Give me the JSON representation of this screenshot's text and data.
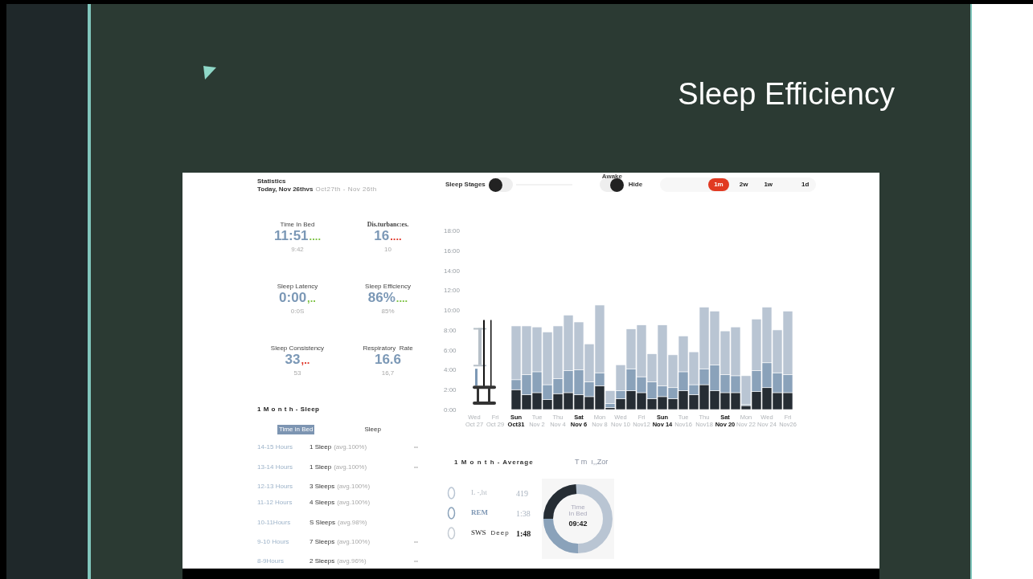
{
  "slide": {
    "title": "Sleep Efficiency"
  },
  "statistics": {
    "title": "Statistics",
    "today": "Today, Nov 26thvs",
    "range": "Oct27th - Nov 26th",
    "metrics": [
      {
        "label": "Time In Bed",
        "value": "11:51",
        "trend": "....",
        "color": "#7cc242",
        "previous": "9:42"
      },
      {
        "label": "Dis.turbanc:es.",
        "value": "16",
        "trend": "....",
        "color": "#e0382c",
        "previous": "10"
      },
      {
        "label": "Sleep Latency",
        "value": "0:00",
        "trend": ",..",
        "color": "#7cc242",
        "previous": "0:0S"
      },
      {
        "label": "Sleep Efficiency",
        "value": "86%",
        "trend": "....",
        "color": "#7cc242",
        "previous": "85%"
      },
      {
        "label": "Sleep Consistency",
        "value": "33",
        "trend": ",..",
        "color": "#e0382c",
        "previous": "53"
      },
      {
        "label": "Respiratory  Rate",
        "value": "16.6",
        "previous": "16,7"
      }
    ]
  },
  "sleep_table": {
    "title": "1 M o n t h - Sleep",
    "columns": [
      {
        "label": "Time in Bed",
        "selected": true
      },
      {
        "label": "Sleep",
        "selected": false
      }
    ],
    "rows": [
      {
        "hours": "14-15 Hours",
        "count": "1 Sleep",
        "avg": "(avg.100%)",
        "note": "••"
      },
      {
        "hours": "13-14 Hours",
        "count": "1 Sleep",
        "avg": "(avg.100%)",
        "note": "••"
      },
      {
        "hours": "12-13 Hours",
        "count": "3 Sleeps",
        "avg": "(avg.100%)"
      },
      {
        "hours": "11-12 Hours",
        "count": "4 Sleeps",
        "avg": "(avg.100%)"
      },
      {
        "hours": "10-11Hours",
        "count": "S Sleeps",
        "avg": "(avg.98%)"
      },
      {
        "hours": "9-10 Hours",
        "count": "7 Sleeps",
        "avg": "(avg.100%)",
        "note": "••"
      },
      {
        "hours": "8-9Hours",
        "count": "2 Sleeps",
        "avg": "(avg.96%)",
        "note": "••"
      }
    ]
  },
  "toolbar": {
    "stages_label": "Sleep Stages",
    "stages_on": false,
    "awake_label": "Awake",
    "awake_on": true,
    "hide_label": "Hide",
    "ranges": [
      {
        "label": "1m",
        "selected": true
      },
      {
        "label": "2w",
        "selected": false
      },
      {
        "label": "1w",
        "selected": false
      },
      {
        "label": "1d",
        "selected": false
      }
    ]
  },
  "chart_data": {
    "type": "bar",
    "stacked": true,
    "categories": [
      "Wed\nOct 27",
      null,
      "Fri\nOct 29",
      null,
      "Sun\nOct31",
      null,
      "Tue\nNov 2",
      null,
      "Thu\nNov 4",
      null,
      "Sat\nNov 6",
      null,
      "Mon\nNov 8",
      null,
      "Wed\nNov 10",
      null,
      "Fri\nNov12",
      null,
      "Sun\nNov 14",
      null,
      "Tue\nNov16",
      null,
      "Thu\nNov18",
      null,
      "Sat\nNov 20",
      null,
      "Mon\nNov 22",
      null,
      "Wed\nNov 24",
      null,
      "Fri\nNov26"
    ],
    "series": [
      {
        "color": "#262d34",
        "values": [
          null,
          null,
          null,
          null,
          2.0,
          1.5,
          1.7,
          1.0,
          1.6,
          1.7,
          1.5,
          1.3,
          2.4,
          0.2,
          1.1,
          1.9,
          1.7,
          1.1,
          1.3,
          1.1,
          1.9,
          1.5,
          2.5,
          1.9,
          1.7,
          1.7,
          0.4,
          1.8,
          2.2,
          1.7,
          1.7
        ]
      },
      {
        "color": "#8aa2ba",
        "values": [
          null,
          null,
          null,
          null,
          1.0,
          2.0,
          2.1,
          1.5,
          1.5,
          2.2,
          2.5,
          1.5,
          1.3,
          0.4,
          0.8,
          2.2,
          1.6,
          1.7,
          1.1,
          1.1,
          1.9,
          1.0,
          1.6,
          2.6,
          1.8,
          1.7,
          0.1,
          2.1,
          2.5,
          2.0,
          1.8
        ]
      },
      {
        "color": "#b9c5d3",
        "values": [
          null,
          null,
          null,
          null,
          5.4,
          4.9,
          4.5,
          5.3,
          5.3,
          5.6,
          4.8,
          3.8,
          6.8,
          1.3,
          2.6,
          4.0,
          5.2,
          2.8,
          6.1,
          3.3,
          3.6,
          3.3,
          6.2,
          5.4,
          4.4,
          4.9,
          2.9,
          5.2,
          5.6,
          4.3,
          6.4
        ]
      }
    ],
    "ylim": [
      0,
      18
    ],
    "yticks": [
      {
        "value": 0,
        "label": "0:00"
      },
      {
        "value": 2,
        "label": "2:00"
      },
      {
        "value": 4,
        "label": "4:00"
      },
      {
        "value": 6,
        "label": "6:00"
      },
      {
        "value": 8,
        "label": "8:00"
      },
      {
        "value": 10,
        "label": "10:00"
      },
      {
        "value": 12,
        "label": "12:00"
      },
      {
        "value": 14,
        "label": "14:00"
      },
      {
        "value": 16,
        "label": "16:00"
      },
      {
        "value": 18,
        "label": "18:00"
      }
    ],
    "xlabel": null
  },
  "average": {
    "title": "1 M o n t h - Average",
    "side_label": "T m  ı,,Zor",
    "legend": [
      {
        "name": "L -,ht",
        "value": "419",
        "color": "#b9c5d3"
      },
      {
        "name": "REM",
        "value": "1:38",
        "color": "#8aa2ba"
      },
      {
        "name": "SWS",
        "extra": "Deep",
        "value": "1:48",
        "color": "#c5ccd4"
      }
    ],
    "donut": {
      "label": "Time\nIn Bed",
      "value": "09:42"
    }
  }
}
